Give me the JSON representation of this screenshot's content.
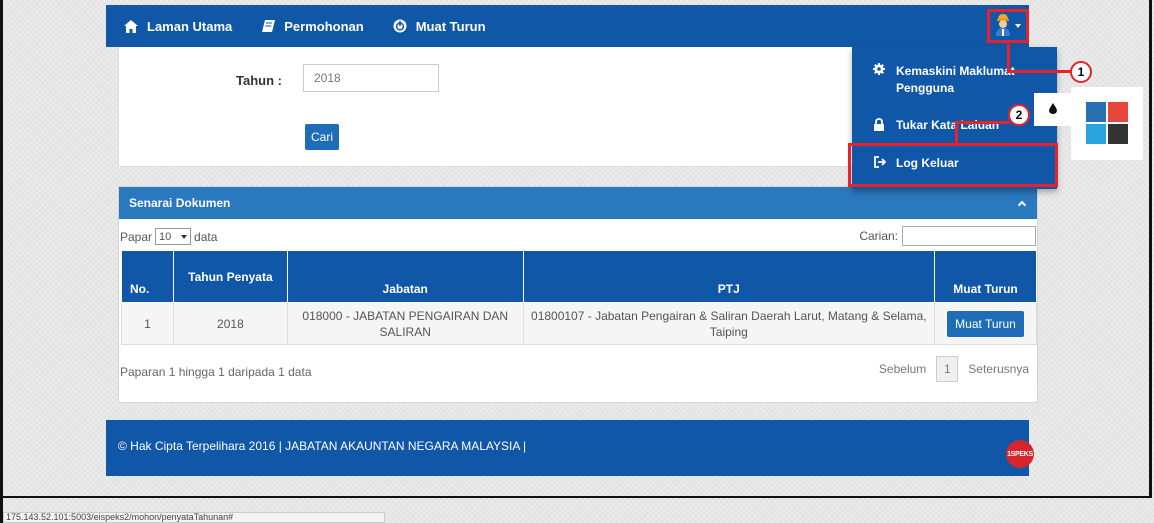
{
  "nav": {
    "items": [
      {
        "label": "Laman Utama",
        "icon": "home-icon"
      },
      {
        "label": "Permohonan",
        "icon": "book-icon"
      },
      {
        "label": "Muat Turun",
        "icon": "power-icon"
      }
    ],
    "user_icon": "user-avatar-icon"
  },
  "search": {
    "tahun_label": "Tahun :",
    "tahun_value": "2018",
    "cari_label": "Cari"
  },
  "documents": {
    "title": "Senarai Dokumen",
    "papar_prefix": "Papar",
    "page_size": "10",
    "papar_suffix": "data",
    "carian_label": "Carian:",
    "columns": [
      "No.",
      "Tahun Penyata",
      "Jabatan",
      "PTJ",
      "Muat Turun"
    ],
    "rows": [
      {
        "no": "1",
        "tahun": "2018",
        "jabatan": "018000 - JABATAN PENGAIRAN DAN SALIRAN",
        "ptj": "01800107 - Jabatan Pengairan & Saliran Daerah Larut, Matang & Selama, Taiping",
        "action": "Muat Turun"
      }
    ],
    "info": "Paparan 1 hingga 1 daripada 1 data",
    "prev": "Sebelum",
    "page": "1",
    "next": "Seterusnya"
  },
  "footer": {
    "text": "© Hak Cipta Terpelihara 2016 | JABATAN AKAUNTAN NEGARA MALAYSIA |",
    "logo_text": "1SPEKS"
  },
  "dropdown": {
    "kemaskini": "Kemaskini Maklumat Pengguna",
    "tukar": "Tukar Kata Laluan",
    "logout": "Log Keluar"
  },
  "callouts": {
    "one": "1",
    "two": "2"
  },
  "colors": {
    "nav_blue": "#1057a8",
    "header_blue": "#2a78be",
    "highlight_red": "#e8222c",
    "swatch_1": "#2a6fb2",
    "swatch_2": "#e8453c",
    "swatch_3": "#29a4e0",
    "swatch_4": "#333333"
  },
  "statusbar": {
    "url": "175.143.52.101:5003/eispeks2/mohon/penyataTahunan#"
  }
}
